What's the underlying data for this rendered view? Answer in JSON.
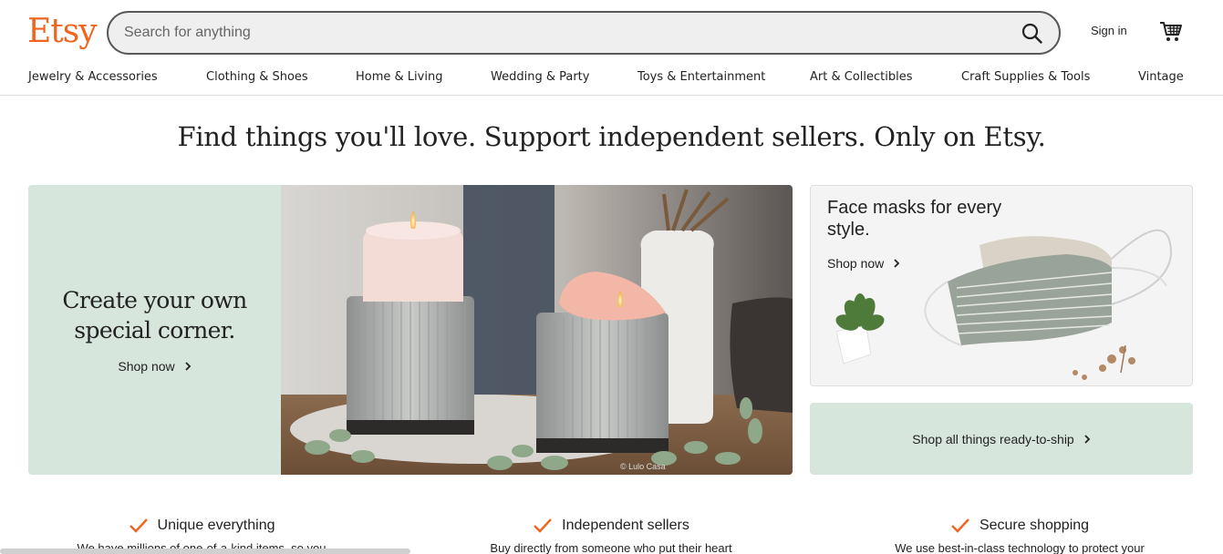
{
  "header": {
    "logo": "Etsy",
    "search_placeholder": "Search for anything",
    "sign_in": "Sign in",
    "accent": "#F1641E"
  },
  "nav": {
    "items": [
      "Jewelry & Accessories",
      "Clothing & Shoes",
      "Home & Living",
      "Wedding & Party",
      "Toys & Entertainment",
      "Art & Collectibles",
      "Craft Supplies & Tools",
      "Vintage"
    ]
  },
  "headline": "Find things you'll love. Support independent sellers. Only on Etsy.",
  "hero": {
    "title": "Create your own special corner.",
    "shop": "Shop now",
    "bg": "#d7e6dd",
    "image_credit": "© Lulo Casa"
  },
  "mask_card": {
    "title": "Face masks for every style.",
    "shop": "Shop now"
  },
  "ready": {
    "label": "Shop all things ready-to-ship"
  },
  "props": [
    {
      "title": "Unique everything",
      "body": "We have millions of one-of-a-kind items, so you"
    },
    {
      "title": "Independent sellers",
      "body": "Buy directly from someone who put their heart"
    },
    {
      "title": "Secure shopping",
      "body": "We use best-in-class technology to protect your"
    }
  ]
}
